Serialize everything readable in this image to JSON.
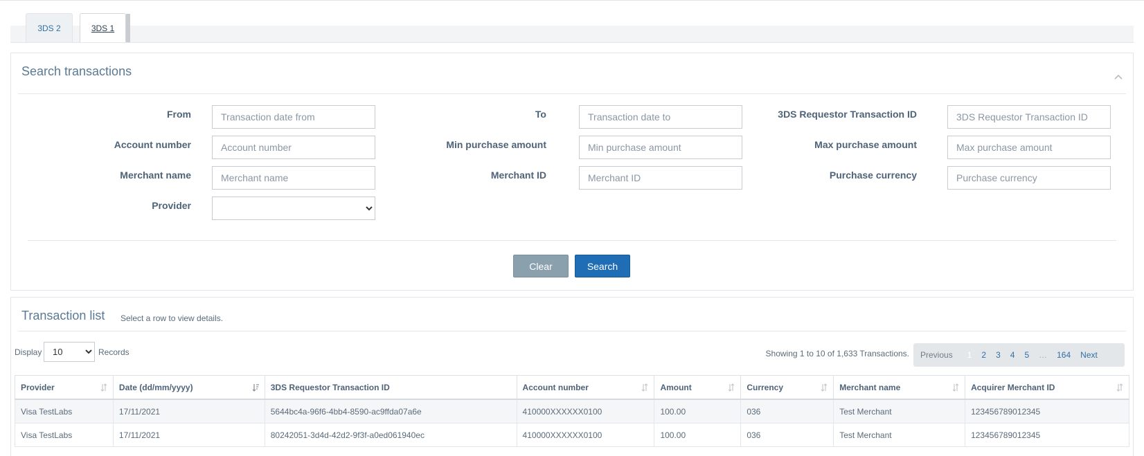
{
  "tabs": [
    {
      "label": "3DS 2"
    },
    {
      "label": "3DS 1"
    }
  ],
  "search": {
    "title": "Search transactions",
    "fields": {
      "from": {
        "label": "From",
        "placeholder": "Transaction date from"
      },
      "to": {
        "label": "To",
        "placeholder": "Transaction date to"
      },
      "requestor_id": {
        "label": "3DS Requestor Transaction ID",
        "placeholder": "3DS Requestor Transaction ID"
      },
      "account": {
        "label": "Account number",
        "placeholder": "Account number"
      },
      "min_amount": {
        "label": "Min purchase amount",
        "placeholder": "Min purchase amount"
      },
      "max_amount": {
        "label": "Max purchase amount",
        "placeholder": "Max purchase amount"
      },
      "merchant_name": {
        "label": "Merchant name",
        "placeholder": "Merchant name"
      },
      "merchant_id": {
        "label": "Merchant ID",
        "placeholder": "Merchant ID"
      },
      "currency": {
        "label": "Purchase currency",
        "placeholder": "Purchase currency"
      },
      "provider": {
        "label": "Provider",
        "value": ""
      }
    },
    "clear_label": "Clear",
    "search_label": "Search"
  },
  "list": {
    "title": "Transaction list",
    "hint": "Select a row to view details.",
    "display_label": "Display",
    "display_value": "10",
    "records_label": "Records",
    "showing": "Showing 1 to 10 of 1,633 Transactions.",
    "pager": {
      "previous": "Previous",
      "pages": [
        "1",
        "2",
        "3",
        "4",
        "5"
      ],
      "ellipsis": "…",
      "last": "164",
      "next": "Next"
    },
    "columns": [
      "Provider",
      "Date (dd/mm/yyyy)",
      "3DS Requestor Transaction ID",
      "Account number",
      "Amount",
      "Currency",
      "Merchant name",
      "Acquirer Merchant ID"
    ],
    "rows": [
      [
        "Visa TestLabs",
        "17/11/2021",
        "5644bc4a-96f6-4bb4-8590-ac9ffda07a6e",
        "410000XXXXXX0100",
        "100.00",
        "036",
        "Test Merchant",
        "123456789012345"
      ],
      [
        "Visa TestLabs",
        "17/11/2021",
        "80242051-3d4d-42d2-9f3f-a0ed061940ec",
        "410000XXXXXX0100",
        "100.00",
        "036",
        "Test Merchant",
        "123456789012345"
      ]
    ]
  },
  "colors": {
    "accent": "#1e6db5",
    "clear_button": "#8aa0ad",
    "label": "#4e6378"
  }
}
